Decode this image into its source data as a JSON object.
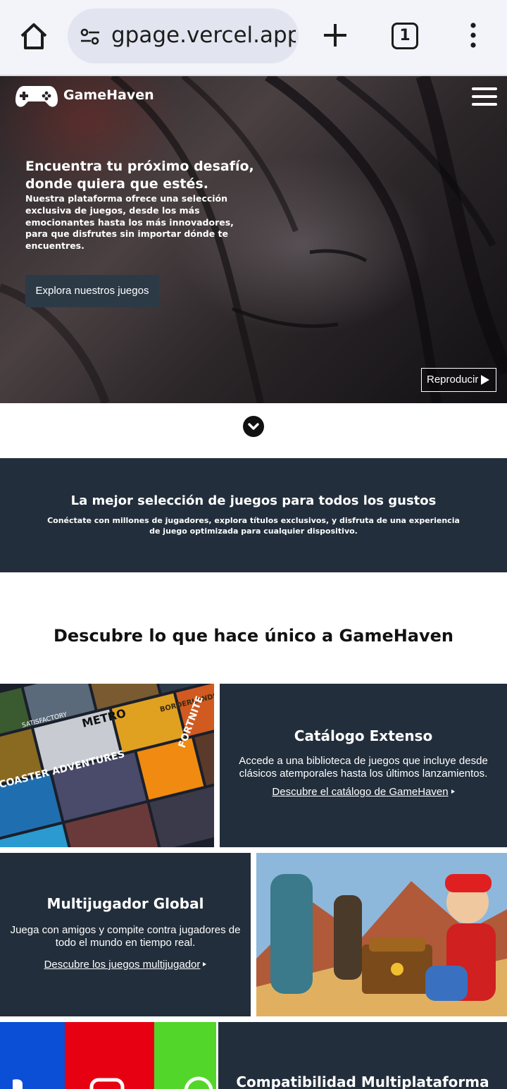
{
  "browser": {
    "url": "gpage.vercel.app",
    "tab_count": "1"
  },
  "header": {
    "brand": "GameHaven"
  },
  "hero": {
    "title": "Encuentra tu próximo desafío, donde quiera que estés.",
    "lead": "Nuestra plataforma ofrece una selección exclusiva de juegos, desde los más emocionantes hasta los más innovadores, para que disfrutes sin importar dónde te encuentres.",
    "cta_label": "Explora nuestros juegos",
    "play_label": "Reproducir"
  },
  "banner": {
    "title": "La mejor selección de juegos para todos los gustos",
    "text": "Conéctate con millones de jugadores, explora títulos exclusivos, y disfruta de una experiencia de juego optimizada para cualquier dispositivo."
  },
  "features": {
    "section_title": "Descubre lo que hace único a GameHaven",
    "catalog": {
      "title": "Catálogo Extenso",
      "text": "Accede a una biblioteca de juegos que incluye desde clásicos atemporales hasta los últimos lanzamientos.",
      "link": "Descubre el catálogo de GameHaven"
    },
    "multiplayer": {
      "title": "Multijugador Global",
      "text": "Juega con amigos y compite contra jugadores de todo el mundo en tiempo real.",
      "link": "Descubre los juegos multijugador"
    },
    "platform": {
      "title": "Compatibilidad Multiplataforma"
    }
  },
  "catalog_covers": [
    "SATISFACTORY",
    "METRO",
    "BORDERLANDS",
    "FORTNITE",
    "COASTER ADVENTURES"
  ],
  "colors": {
    "dark_panel": "#222e3b",
    "button": "#2c3a46",
    "playstation": "#0a4fd6",
    "nintendo": "#e60012",
    "xbox": "#52d62a"
  }
}
